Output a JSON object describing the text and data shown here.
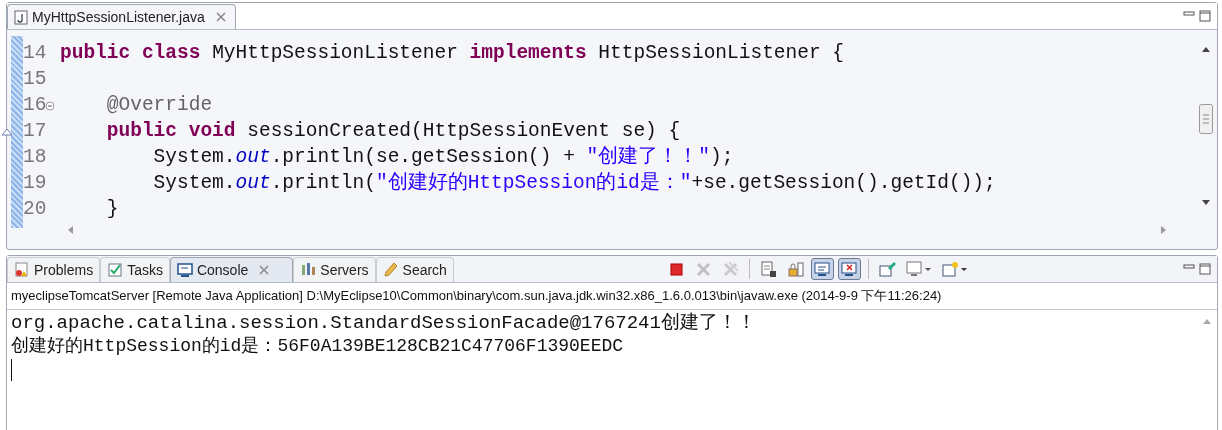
{
  "editor": {
    "tabs": [
      {
        "label": "MyHttpSessionListener.java",
        "selected": true,
        "closable": true
      }
    ],
    "lines": [
      {
        "number": "14",
        "kind": "plain",
        "segments": [
          {
            "kind": "keyword",
            "text": "public class"
          },
          {
            "kind": "plain",
            "text": " MyHttpSessionListener "
          },
          {
            "kind": "keyword",
            "text": "implements"
          },
          {
            "kind": "plain",
            "text": " HttpSessionListener {"
          }
        ]
      },
      {
        "number": "15",
        "kind": "plain"
      },
      {
        "number": "16",
        "kind": "fold",
        "segments": [
          {
            "kind": "annotation",
            "text": "    @Override"
          }
        ]
      },
      {
        "number": "17",
        "kind": "override",
        "segments": [
          {
            "kind": "keyword",
            "text": "    public void"
          },
          {
            "kind": "plain",
            "text": " sessionCreated(HttpSessionEvent se) {"
          }
        ]
      },
      {
        "number": "18",
        "kind": "plain",
        "segments": [
          {
            "kind": "plain",
            "text": "        System."
          },
          {
            "kind": "field",
            "text": "out"
          },
          {
            "kind": "plain",
            "text": ".println(se.getSession() + "
          },
          {
            "kind": "string",
            "text": "\"创建了！！\""
          },
          {
            "kind": "plain",
            "text": ");"
          }
        ]
      },
      {
        "number": "19",
        "kind": "plain",
        "segments": [
          {
            "kind": "plain",
            "text": "        System."
          },
          {
            "kind": "field",
            "text": "out"
          },
          {
            "kind": "plain",
            "text": ".println("
          },
          {
            "kind": "string",
            "text": "\"创建好的HttpSession的id是：\""
          },
          {
            "kind": "plain",
            "text": "+se.getSession().getId());"
          }
        ]
      },
      {
        "number": "20",
        "kind": "plain",
        "segments": [
          {
            "kind": "plain",
            "text": "    }"
          }
        ]
      }
    ]
  },
  "views": {
    "tabs": [
      {
        "label": "Problems",
        "selected": false,
        "closable": false
      },
      {
        "label": "Tasks",
        "selected": false,
        "closable": false
      },
      {
        "label": "Console",
        "selected": true,
        "closable": true
      },
      {
        "label": "Servers",
        "selected": false,
        "closable": false
      },
      {
        "label": "Search",
        "selected": false,
        "closable": false
      }
    ],
    "toolbar": [
      {
        "kind": "terminate",
        "disabled": false,
        "on": false
      },
      {
        "kind": "remove",
        "disabled": true,
        "on": false
      },
      {
        "kind": "remove-all",
        "disabled": true,
        "on": false
      },
      {
        "kind": "sep"
      },
      {
        "kind": "clear",
        "disabled": false,
        "on": false
      },
      {
        "kind": "scroll-lock",
        "disabled": false,
        "on": false
      },
      {
        "kind": "show-out",
        "disabled": false,
        "on": true
      },
      {
        "kind": "show-err",
        "disabled": false,
        "on": true
      },
      {
        "kind": "sep"
      },
      {
        "kind": "pin",
        "disabled": false,
        "on": false
      },
      {
        "kind": "display",
        "disabled": false,
        "on": false
      },
      {
        "kind": "new-console",
        "disabled": false,
        "on": false
      }
    ],
    "description": "myeclipseTomcatServer [Remote Java Application] D:\\MyEclipse10\\Common\\binary\\com.sun.java.jdk.win32.x86_1.6.0.013\\bin\\javaw.exe (2014-9-9 下午11:26:24)",
    "output": [
      "org.apache.catalina.session.StandardSessionFacade@1767241创建了！！",
      "创建好的HttpSession的id是：56F0A139BE128CB21C47706F1390EEDC"
    ]
  }
}
